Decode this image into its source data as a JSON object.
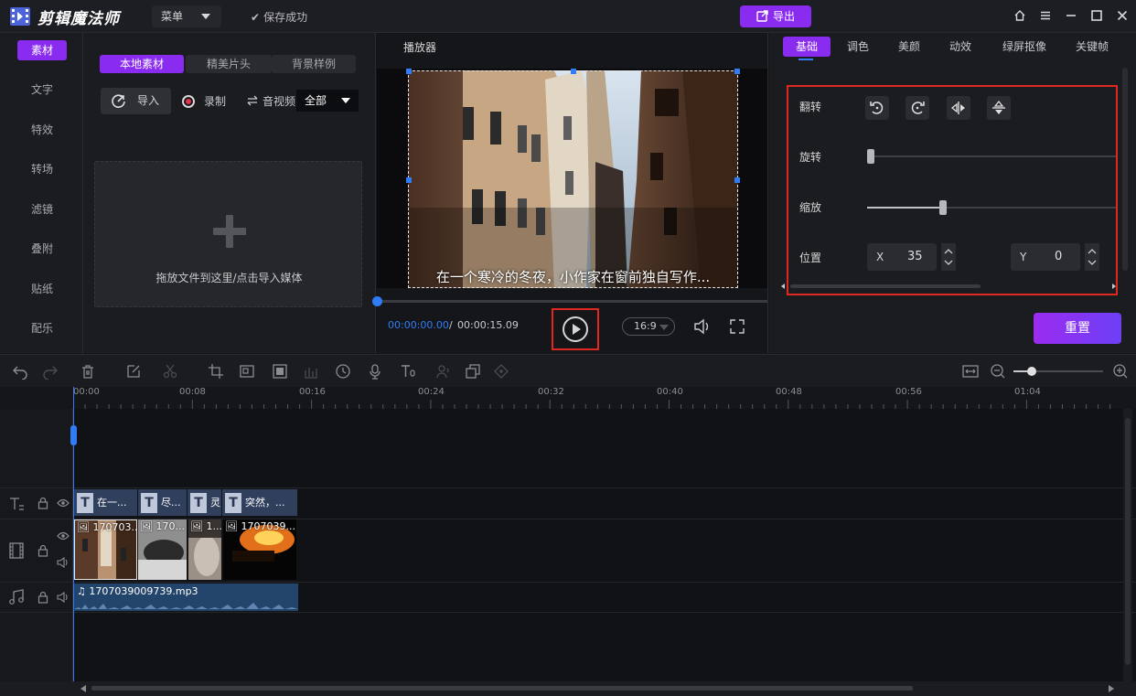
{
  "app": {
    "name": "剪辑魔法师",
    "menu_label": "菜单",
    "save_status": "保存成功",
    "export_label": "导出"
  },
  "left_nav": {
    "items": [
      "素材",
      "文字",
      "特效",
      "转场",
      "滤镜",
      "叠附",
      "贴纸",
      "配乐"
    ],
    "active_index": 0
  },
  "media": {
    "tabs": [
      "本地素材",
      "精美片头",
      "背景样例"
    ],
    "import_label": "导入",
    "record_label": "录制",
    "av_label": "音视频",
    "filter_value": "全部",
    "drop_hint": "拖放文件到这里/点击导入媒体"
  },
  "player": {
    "title": "播放器",
    "subtitle": "在一个寒冷的冬夜，小作家在窗前独自写作...",
    "current_time": "00:00:00.00",
    "separator": "/",
    "total_time": "00:00:15.09",
    "aspect_ratio": "16:9",
    "progress": 0
  },
  "properties": {
    "tabs": [
      "基础",
      "调色",
      "美颜",
      "动效",
      "绿屏抠像",
      "关键帧"
    ],
    "flip_label": "翻转",
    "rotate_label": "旋转",
    "scale_label": "缩放",
    "position_label": "位置",
    "x_label": "X",
    "x_value": "35",
    "y_label": "Y",
    "y_value": "0",
    "rotate_level": 0,
    "scale_level": 0.29,
    "reset_label": "重置"
  },
  "timeline": {
    "ruler_labels": [
      "00:00",
      "00:08",
      "00:16",
      "00:24",
      "00:32",
      "00:40",
      "00:48",
      "00:56",
      "01:04"
    ],
    "text_clips": [
      "在一...",
      "尽...",
      "灵",
      "突然，..."
    ],
    "video_clips": [
      "170703...",
      "170...",
      "1...",
      "1707039..."
    ],
    "audio_clip": "1707039009739.mp3",
    "zoom_level": 0.2
  },
  "colors": {
    "accent": "#8a2cf0",
    "highlight": "#2f7cf6",
    "annotation": "#e0281f"
  }
}
